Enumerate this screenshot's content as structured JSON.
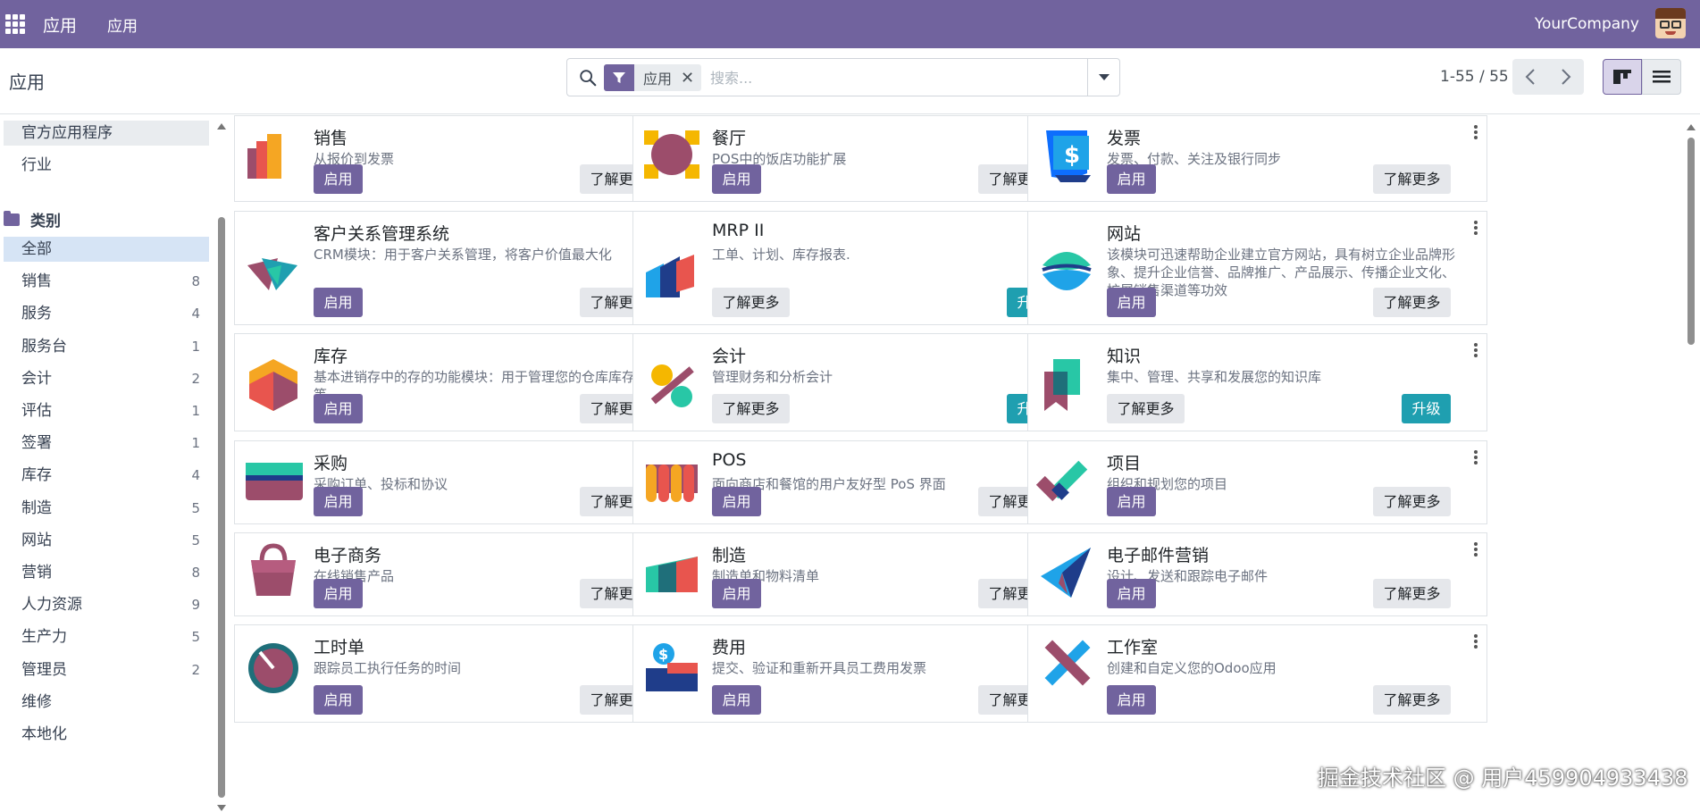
{
  "topbar": {
    "app_name": "应用",
    "menu_item": "应用",
    "company": "YourCompany"
  },
  "control": {
    "page_title": "应用",
    "facet_label": "应用",
    "facet_close": "✕",
    "search_placeholder": "搜索...",
    "pager": "1-55 / 55"
  },
  "sidebar": {
    "top_items": [
      {
        "label": "官方应用程序"
      },
      {
        "label": "行业"
      }
    ],
    "category_header": "类别",
    "categories": [
      {
        "label": "全部",
        "count": ""
      },
      {
        "label": "销售",
        "count": "8"
      },
      {
        "label": "服务",
        "count": "4"
      },
      {
        "label": "服务台",
        "count": "1"
      },
      {
        "label": "会计",
        "count": "2"
      },
      {
        "label": "评估",
        "count": "1"
      },
      {
        "label": "签署",
        "count": "1"
      },
      {
        "label": "库存",
        "count": "4"
      },
      {
        "label": "制造",
        "count": "5"
      },
      {
        "label": "网站",
        "count": "5"
      },
      {
        "label": "营销",
        "count": "8"
      },
      {
        "label": "人力资源",
        "count": "9"
      },
      {
        "label": "生产力",
        "count": "5"
      },
      {
        "label": "管理员",
        "count": "2"
      },
      {
        "label": "维修",
        "count": ""
      },
      {
        "label": "本地化",
        "count": ""
      }
    ]
  },
  "labels": {
    "activate": "启用",
    "learn_more": "了解更多",
    "upgrade": "升级"
  },
  "apps": [
    {
      "title": "销售",
      "desc": "从报价到发票",
      "icon": "sales-icon"
    },
    {
      "title": "餐厅",
      "desc": "POS中的饭店功能扩展",
      "icon": "restaurant-icon"
    },
    {
      "title": "发票",
      "desc": "发票、付款、关注及银行同步",
      "icon": "invoice-icon"
    },
    {
      "title": "客户关系管理系统",
      "desc": "CRM模块：用于客户关系管理，将客户价值最大化",
      "icon": "crm-icon"
    },
    {
      "title": "MRP II",
      "desc": "工单、计划、库存报表.",
      "icon": "mrp-icon"
    },
    {
      "title": "网站",
      "desc": "该模块可迅速帮助企业建立官方网站，具有树立企业品牌形象、提升企业信誉、品牌推广、产品展示、传播企业文化、扩展销售渠道等功效",
      "icon": "website-icon"
    },
    {
      "title": "库存",
      "desc": "基本进销存中的存的功能模块：用于管理您的仓库库存管理等",
      "icon": "inventory-icon"
    },
    {
      "title": "会计",
      "desc": "管理财务和分析会计",
      "icon": "accounting-icon"
    },
    {
      "title": "知识",
      "desc": "集中、管理、共享和发展您的知识库",
      "icon": "knowledge-icon"
    },
    {
      "title": "采购",
      "desc": "采购订单、投标和协议",
      "icon": "purchase-icon"
    },
    {
      "title": "POS",
      "desc": "面向商店和餐馆的用户友好型 PoS 界面",
      "icon": "pos-icon"
    },
    {
      "title": "项目",
      "desc": "组织和规划您的项目",
      "icon": "project-icon"
    },
    {
      "title": "电子商务",
      "desc": "在线销售产品",
      "icon": "ecommerce-icon"
    },
    {
      "title": "制造",
      "desc": "制造单和物料清单",
      "icon": "manufacturing-icon"
    },
    {
      "title": "电子邮件营销",
      "desc": "设计、发送和跟踪电子邮件",
      "icon": "email-marketing-icon"
    },
    {
      "title": "工时单",
      "desc": "跟踪员工执行任务的时间",
      "icon": "timesheet-icon"
    },
    {
      "title": "费用",
      "desc": "提交、验证和重新开具员工费用发票",
      "icon": "expenses-icon"
    },
    {
      "title": "工作室",
      "desc": "创建和自定义您的Odoo应用",
      "icon": "studio-icon"
    }
  ],
  "watermark": "掘金技术社区 @ 用户459904933438",
  "colors": {
    "brand": "#71639e",
    "upgrade": "#1f9fb0",
    "active_category": "#d6e4f5"
  }
}
